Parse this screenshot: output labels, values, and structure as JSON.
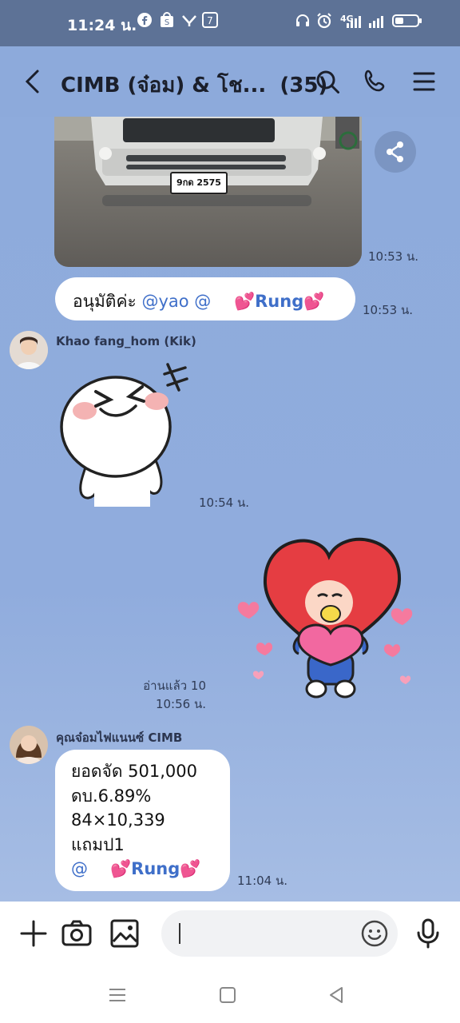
{
  "status_bar": {
    "time": "11:24 น.",
    "network": "4G"
  },
  "header": {
    "title": "CIMB (จ๋อม) & โช...",
    "member_count": "(35)"
  },
  "messages": [
    {
      "kind": "image",
      "caption_plate": "9กด 2575",
      "time": "10:53 น."
    },
    {
      "kind": "text",
      "text_prefix": "อนุมัติค่ะ ",
      "mention1": "@yao",
      "mention2": "@",
      "mention_name": "Rung",
      "time": "10:53 น."
    },
    {
      "kind": "sticker",
      "sender": "Khao fang_hom (Kik)",
      "time": "10:54 น."
    },
    {
      "kind": "sticker_out",
      "read": "อ่านแล้ว 10",
      "time": "10:56 น."
    },
    {
      "kind": "text",
      "sender": "คุณจ๋อมไฟแนนซ์ CIMB",
      "lines": [
        "ยอดจัด 501,000",
        "ดบ.6.89%",
        "84×10,339",
        "แถมป1"
      ],
      "mention_at": "@",
      "mention_name": "Rung",
      "time": "11:04 น."
    }
  ],
  "icons": {
    "back": "back-icon",
    "search": "search-icon",
    "call": "phone-icon",
    "menu": "menu-icon",
    "share": "share-icon",
    "plus": "plus-icon",
    "camera": "camera-icon",
    "gallery": "image-icon",
    "emoji": "emoji-icon",
    "mic": "mic-icon"
  },
  "colors": {
    "mention": "#3f6fc9",
    "chat_bg": "#8daadb",
    "statusbar": "#5d7296"
  }
}
